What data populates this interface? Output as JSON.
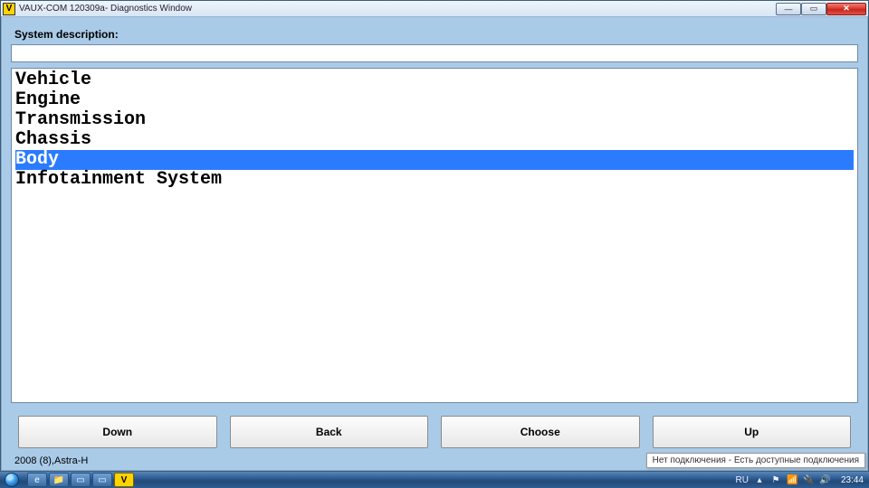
{
  "window": {
    "title": "VAUX-COM 120309a- Diagnostics Window",
    "app_icon_letter": "V"
  },
  "label": "System description:",
  "description_value": "",
  "systems": [
    {
      "label": "Vehicle",
      "selected": false
    },
    {
      "label": "Engine",
      "selected": false
    },
    {
      "label": "Transmission",
      "selected": false
    },
    {
      "label": "Chassis",
      "selected": false
    },
    {
      "label": "Body",
      "selected": true
    },
    {
      "label": "Infotainment System",
      "selected": false
    }
  ],
  "buttons": {
    "down": "Down",
    "back": "Back",
    "choose": "Choose",
    "up": "Up"
  },
  "status_text": "2008 (8),Astra-H",
  "network_balloon": "Нет подключения - Есть доступные подключения",
  "taskbar": {
    "lang": "RU",
    "clock": "23:44"
  }
}
